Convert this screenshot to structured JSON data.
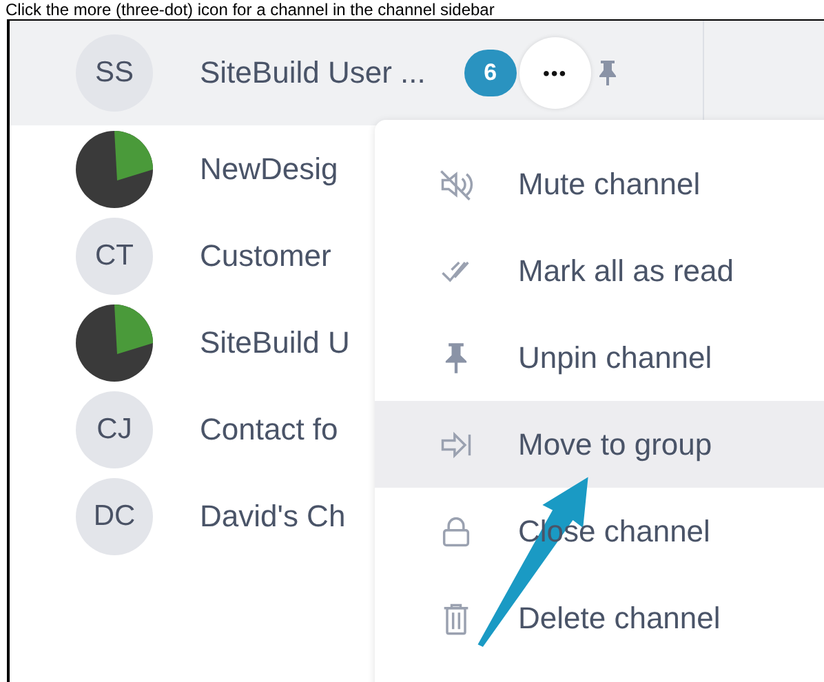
{
  "caption": "Click the more (three-dot) icon for a channel in the channel sidebar",
  "channels": [
    {
      "kind": "initials",
      "initials": "SS",
      "name": "SiteBuild User ...",
      "selected": true,
      "badge": "6",
      "more": "•••",
      "pinned": true
    },
    {
      "kind": "photo",
      "name": "NewDesig",
      "selected": false
    },
    {
      "kind": "initials",
      "initials": "CT",
      "name": "Customer",
      "selected": false
    },
    {
      "kind": "photo",
      "name": "SiteBuild U",
      "selected": false
    },
    {
      "kind": "initials",
      "initials": "CJ",
      "name": "Contact fo",
      "selected": false
    },
    {
      "kind": "initials",
      "initials": "DC",
      "name": "David's Ch",
      "selected": false
    }
  ],
  "menu": {
    "items": [
      {
        "label": "Mute channel",
        "highlighted": false
      },
      {
        "label": "Mark all as read",
        "highlighted": false
      },
      {
        "label": "Unpin channel",
        "highlighted": false
      },
      {
        "label": "Move to group",
        "highlighted": true
      },
      {
        "label": "Close channel",
        "highlighted": false
      },
      {
        "label": "Delete channel",
        "highlighted": false
      }
    ]
  }
}
